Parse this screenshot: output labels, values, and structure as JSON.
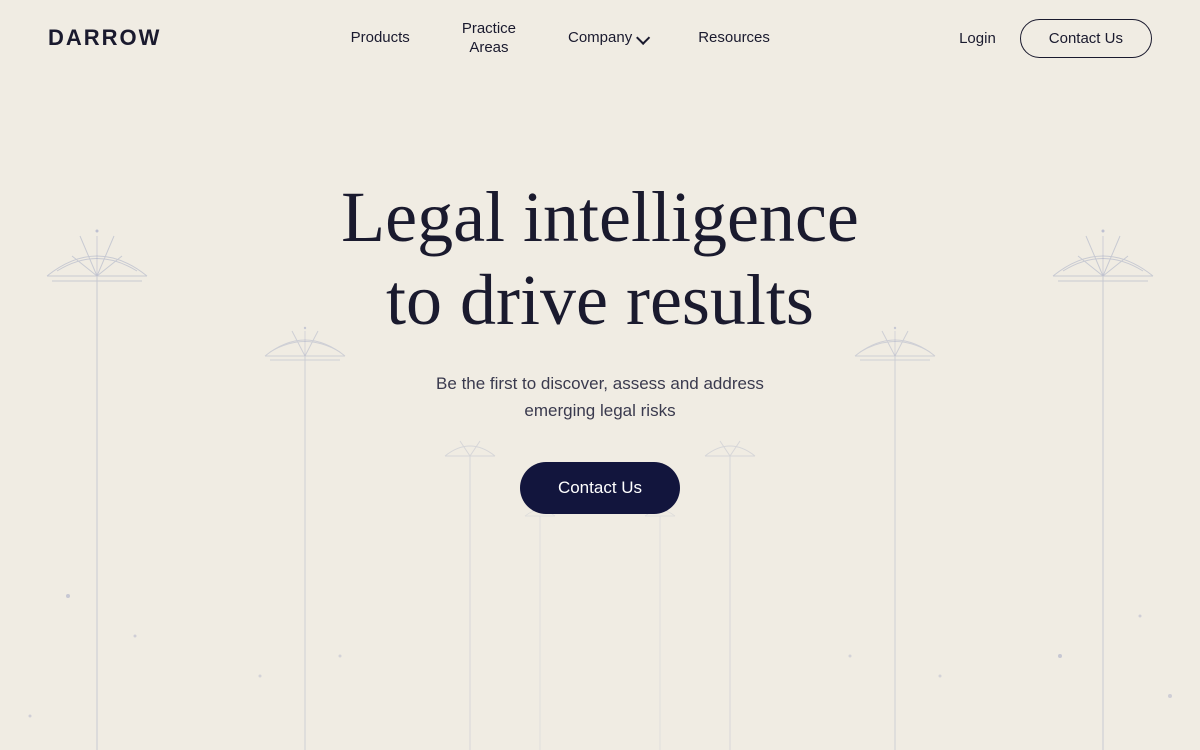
{
  "brand": {
    "logo": "DARROW"
  },
  "nav": {
    "links": [
      {
        "id": "products",
        "label": "Products"
      },
      {
        "id": "practice-areas",
        "label": "Practice\nAreas"
      },
      {
        "id": "company",
        "label": "Company",
        "hasDropdown": true
      },
      {
        "id": "resources",
        "label": "Resources"
      }
    ],
    "login_label": "Login",
    "contact_label": "Contact Us"
  },
  "hero": {
    "title_line1": "Legal intelligence",
    "title_line2": "to drive results",
    "subtitle_line1": "Be the first to discover, assess and address",
    "subtitle_line2": "emerging legal risks",
    "cta_label": "Contact Us"
  },
  "colors": {
    "background": "#f0ece3",
    "dark_navy": "#12153d",
    "text_dark": "#1a1a2e",
    "column_stroke": "#c0c4d8"
  }
}
